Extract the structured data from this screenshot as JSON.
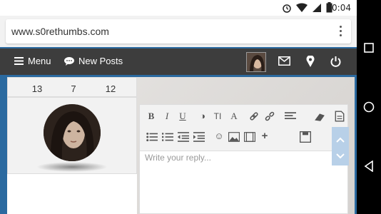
{
  "status": {
    "time": "20:04"
  },
  "browser": {
    "url": "www.s0rethumbs.com"
  },
  "nav": {
    "menu_label": "Menu",
    "new_posts_label": "New Posts"
  },
  "stats": [
    "13",
    "7",
    "12"
  ],
  "editor": {
    "placeholder": "Write your reply..."
  },
  "colors": {
    "navbar": "#3d3d3d",
    "accent": "#2b6aa0",
    "scroll": "#b8d0e8"
  },
  "icons": {
    "status": [
      "alarm-icon",
      "wifi-icon",
      "signal-icon",
      "battery-icon"
    ],
    "toolbar_row1": [
      "bold-icon",
      "italic-icon",
      "underline-icon",
      "color-icon",
      "text-size-icon",
      "font-icon",
      "link-icon",
      "unlink-icon",
      "align-icon",
      "eraser-icon",
      "source-icon"
    ],
    "toolbar_row2": [
      "bullet-list-icon",
      "numbered-list-icon",
      "outdent-icon",
      "indent-icon",
      "smiley-icon",
      "image-icon",
      "media-icon",
      "insert-more-icon",
      "save-icon"
    ],
    "android_nav": [
      "recents-icon",
      "home-icon",
      "back-icon"
    ]
  }
}
